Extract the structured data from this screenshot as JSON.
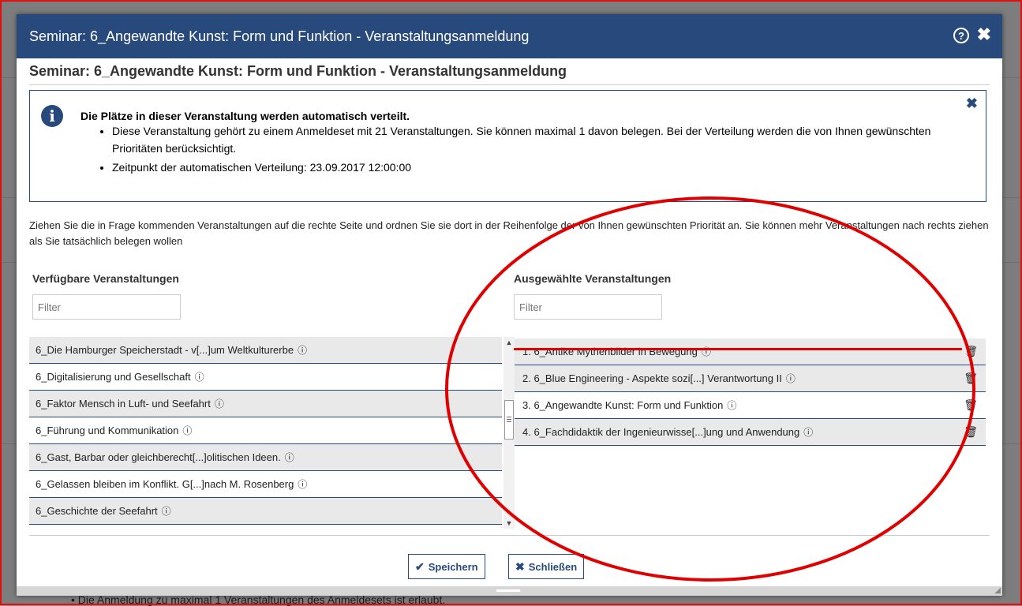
{
  "background": {
    "bottom_text": "• Die Anmeldung zu maximal 1 Veranstaltungen des Anmeldesets ist erlaubt."
  },
  "dialog": {
    "title": "Seminar: 6_Angewandte Kunst: Form und Funktion - Veranstaltungsanmeldung",
    "help_label": "?",
    "close_label": "✖",
    "heading": "Seminar: 6_Angewandte Kunst: Form und Funktion - Veranstaltungsanmeldung"
  },
  "info": {
    "icon": "i",
    "close_label": "✖",
    "headline": "Die Plätze in dieser Veranstaltung werden automatisch verteilt.",
    "bullets": [
      "Diese Veranstaltung gehört zu einem Anmeldeset mit 21 Veranstaltungen. Sie können maximal 1 davon belegen. Bei der Verteilung werden die von Ihnen gewünschten Prioritäten berücksichtigt.",
      "Zeitpunkt der automatischen Verteilung: 23.09.2017 12:00:00"
    ]
  },
  "instructions": "Ziehen Sie die in Frage kommenden Veranstaltungen auf die rechte Seite und ordnen Sie sie dort in der Reihenfolge der von Ihnen gewünschten Priorität an. Sie können mehr Veranstaltungen nach rechts ziehen als Sie tatsächlich belegen wollen",
  "available": {
    "label": "Verfügbare Veranstaltungen",
    "filter_placeholder": "Filter",
    "items": [
      "6_Die Hamburger Speicherstadt - v[...]um Weltkulturerbe",
      "6_Digitalisierung und Gesellschaft",
      "6_Faktor Mensch in Luft- und Seefahrt",
      "6_Führung und Kommunikation",
      "6_Gast, Barbar oder gleichberecht[...]olitischen Ideen.",
      "6_Gelassen bleiben im Konflikt. G[...]nach M. Rosenberg",
      "6_Geschichte der Seefahrt"
    ]
  },
  "selected": {
    "label": "Ausgewählte Veranstaltungen",
    "filter_placeholder": "Filter",
    "items": [
      "1. 6_Antike Mythenbilder in Bewegung",
      "2. 6_Blue Engineering - Aspekte sozi[...] Verantwortung II",
      "3. 6_Angewandte Kunst: Form und Funktion",
      "4. 6_Fachdidaktik der Ingenieurwisse[...]ung und Anwendung"
    ]
  },
  "info_glyph": "ⓘ",
  "trash_glyph": "🗑",
  "buttons": {
    "save": "Speichern",
    "save_icon": "✔",
    "close": "Schließen",
    "close_icon": "✖"
  },
  "annotation_color": "#e00000"
}
